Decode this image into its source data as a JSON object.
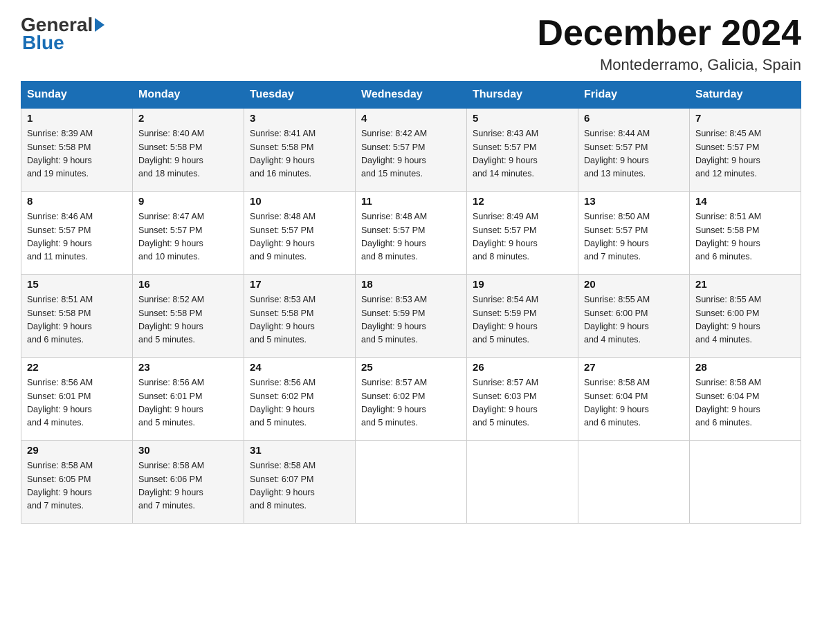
{
  "logo": {
    "general": "General",
    "blue": "Blue"
  },
  "title": "December 2024",
  "subtitle": "Montederramo, Galicia, Spain",
  "days_of_week": [
    "Sunday",
    "Monday",
    "Tuesday",
    "Wednesday",
    "Thursday",
    "Friday",
    "Saturday"
  ],
  "weeks": [
    [
      {
        "day": "1",
        "sunrise": "8:39 AM",
        "sunset": "5:58 PM",
        "daylight": "9 hours and 19 minutes."
      },
      {
        "day": "2",
        "sunrise": "8:40 AM",
        "sunset": "5:58 PM",
        "daylight": "9 hours and 18 minutes."
      },
      {
        "day": "3",
        "sunrise": "8:41 AM",
        "sunset": "5:58 PM",
        "daylight": "9 hours and 16 minutes."
      },
      {
        "day": "4",
        "sunrise": "8:42 AM",
        "sunset": "5:57 PM",
        "daylight": "9 hours and 15 minutes."
      },
      {
        "day": "5",
        "sunrise": "8:43 AM",
        "sunset": "5:57 PM",
        "daylight": "9 hours and 14 minutes."
      },
      {
        "day": "6",
        "sunrise": "8:44 AM",
        "sunset": "5:57 PM",
        "daylight": "9 hours and 13 minutes."
      },
      {
        "day": "7",
        "sunrise": "8:45 AM",
        "sunset": "5:57 PM",
        "daylight": "9 hours and 12 minutes."
      }
    ],
    [
      {
        "day": "8",
        "sunrise": "8:46 AM",
        "sunset": "5:57 PM",
        "daylight": "9 hours and 11 minutes."
      },
      {
        "day": "9",
        "sunrise": "8:47 AM",
        "sunset": "5:57 PM",
        "daylight": "9 hours and 10 minutes."
      },
      {
        "day": "10",
        "sunrise": "8:48 AM",
        "sunset": "5:57 PM",
        "daylight": "9 hours and 9 minutes."
      },
      {
        "day": "11",
        "sunrise": "8:48 AM",
        "sunset": "5:57 PM",
        "daylight": "9 hours and 8 minutes."
      },
      {
        "day": "12",
        "sunrise": "8:49 AM",
        "sunset": "5:57 PM",
        "daylight": "9 hours and 8 minutes."
      },
      {
        "day": "13",
        "sunrise": "8:50 AM",
        "sunset": "5:57 PM",
        "daylight": "9 hours and 7 minutes."
      },
      {
        "day": "14",
        "sunrise": "8:51 AM",
        "sunset": "5:58 PM",
        "daylight": "9 hours and 6 minutes."
      }
    ],
    [
      {
        "day": "15",
        "sunrise": "8:51 AM",
        "sunset": "5:58 PM",
        "daylight": "9 hours and 6 minutes."
      },
      {
        "day": "16",
        "sunrise": "8:52 AM",
        "sunset": "5:58 PM",
        "daylight": "9 hours and 5 minutes."
      },
      {
        "day": "17",
        "sunrise": "8:53 AM",
        "sunset": "5:58 PM",
        "daylight": "9 hours and 5 minutes."
      },
      {
        "day": "18",
        "sunrise": "8:53 AM",
        "sunset": "5:59 PM",
        "daylight": "9 hours and 5 minutes."
      },
      {
        "day": "19",
        "sunrise": "8:54 AM",
        "sunset": "5:59 PM",
        "daylight": "9 hours and 5 minutes."
      },
      {
        "day": "20",
        "sunrise": "8:55 AM",
        "sunset": "6:00 PM",
        "daylight": "9 hours and 4 minutes."
      },
      {
        "day": "21",
        "sunrise": "8:55 AM",
        "sunset": "6:00 PM",
        "daylight": "9 hours and 4 minutes."
      }
    ],
    [
      {
        "day": "22",
        "sunrise": "8:56 AM",
        "sunset": "6:01 PM",
        "daylight": "9 hours and 4 minutes."
      },
      {
        "day": "23",
        "sunrise": "8:56 AM",
        "sunset": "6:01 PM",
        "daylight": "9 hours and 5 minutes."
      },
      {
        "day": "24",
        "sunrise": "8:56 AM",
        "sunset": "6:02 PM",
        "daylight": "9 hours and 5 minutes."
      },
      {
        "day": "25",
        "sunrise": "8:57 AM",
        "sunset": "6:02 PM",
        "daylight": "9 hours and 5 minutes."
      },
      {
        "day": "26",
        "sunrise": "8:57 AM",
        "sunset": "6:03 PM",
        "daylight": "9 hours and 5 minutes."
      },
      {
        "day": "27",
        "sunrise": "8:58 AM",
        "sunset": "6:04 PM",
        "daylight": "9 hours and 6 minutes."
      },
      {
        "day": "28",
        "sunrise": "8:58 AM",
        "sunset": "6:04 PM",
        "daylight": "9 hours and 6 minutes."
      }
    ],
    [
      {
        "day": "29",
        "sunrise": "8:58 AM",
        "sunset": "6:05 PM",
        "daylight": "9 hours and 7 minutes."
      },
      {
        "day": "30",
        "sunrise": "8:58 AM",
        "sunset": "6:06 PM",
        "daylight": "9 hours and 7 minutes."
      },
      {
        "day": "31",
        "sunrise": "8:58 AM",
        "sunset": "6:07 PM",
        "daylight": "9 hours and 8 minutes."
      },
      null,
      null,
      null,
      null
    ]
  ]
}
